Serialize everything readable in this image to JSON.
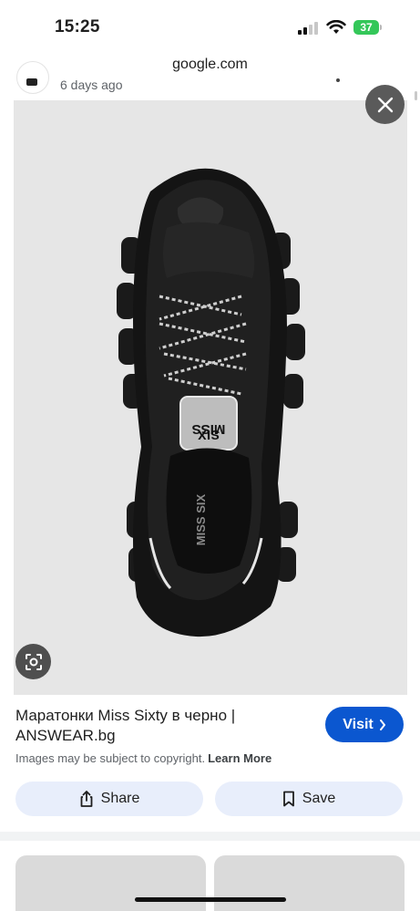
{
  "status_bar": {
    "time": "15:25",
    "battery": "37"
  },
  "browser": {
    "url": "google.com"
  },
  "previous_result": {
    "time_ago": "6 days ago"
  },
  "image": {
    "brand_text": "MISS SIX",
    "alt": "black chunky sneaker top view"
  },
  "result": {
    "title": "Маратонки Miss Sixty в черно | ANSWEAR.bg",
    "visit_label": "Visit",
    "copyright_text": "Images may be subject to copyright.",
    "learn_more_label": "Learn More"
  },
  "actions": {
    "share_label": "Share",
    "save_label": "Save"
  },
  "colors": {
    "accent": "#0b57d0",
    "pill_bg": "#e8eefb",
    "panel_bg": "#e6e6e6",
    "battery": "#34c759"
  },
  "icons": {
    "close": "close-icon",
    "lens": "lens-icon",
    "share": "share-icon",
    "save": "bookmark-icon",
    "visit": "chevron-right-icon"
  }
}
